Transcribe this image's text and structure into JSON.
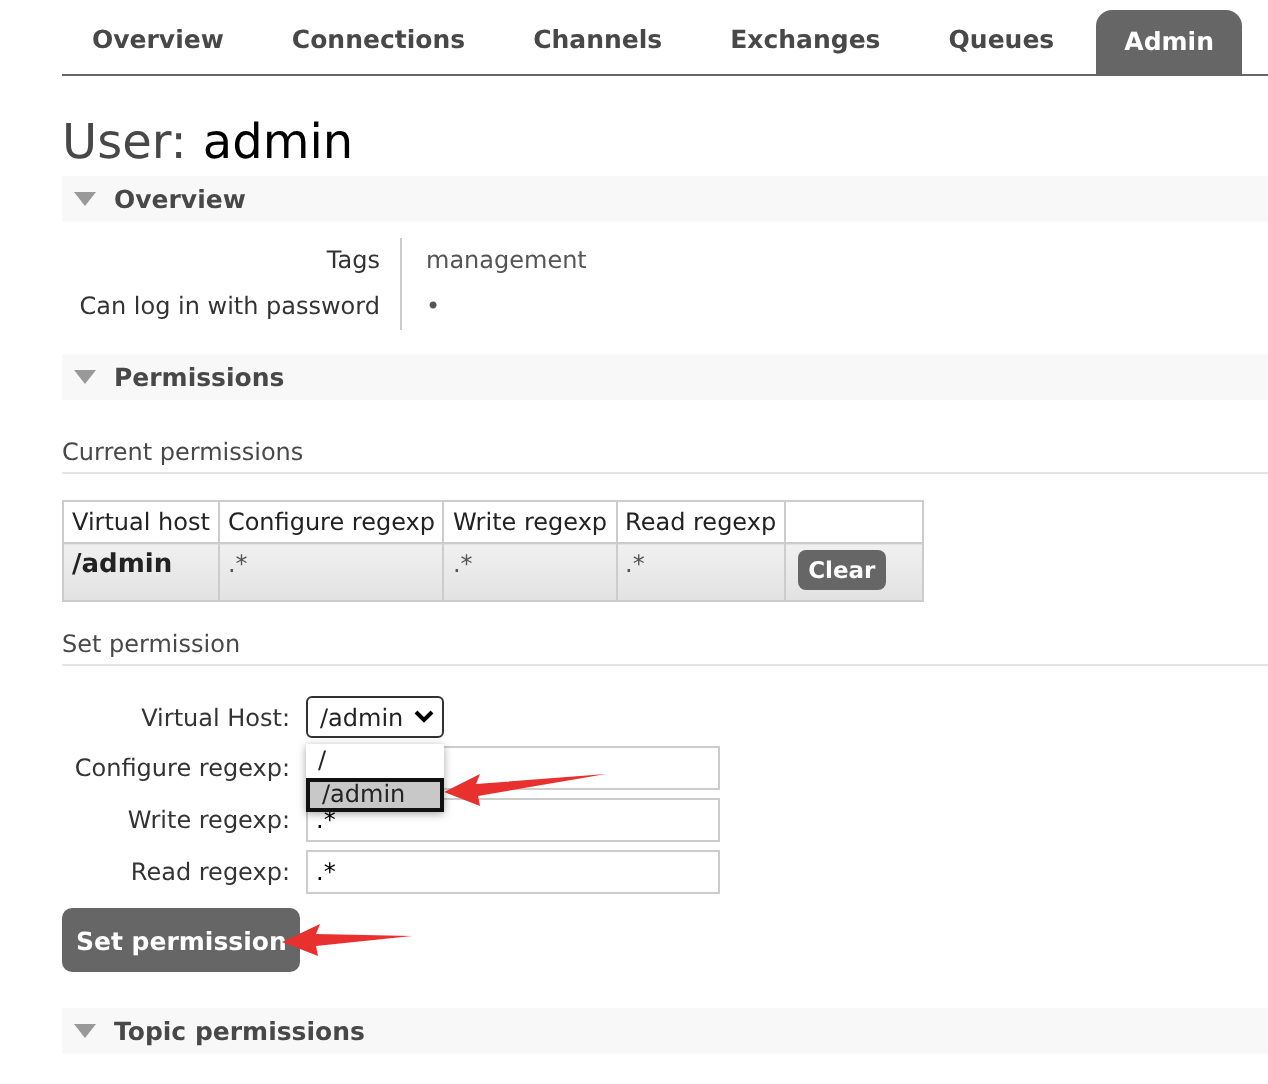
{
  "tabs": [
    {
      "label": "Overview",
      "selected": false
    },
    {
      "label": "Connections",
      "selected": false
    },
    {
      "label": "Channels",
      "selected": false
    },
    {
      "label": "Exchanges",
      "selected": false
    },
    {
      "label": "Queues",
      "selected": false
    },
    {
      "label": "Admin",
      "selected": true
    }
  ],
  "title": {
    "label": "User:",
    "name": "admin"
  },
  "overview": {
    "heading": "Overview",
    "expanded": true,
    "rows": [
      {
        "key": "Tags",
        "value": "management"
      },
      {
        "key": "Can log in with password",
        "value": "•"
      }
    ]
  },
  "permissions": {
    "heading": "Permissions",
    "expanded": true,
    "current": {
      "heading": "Current permissions",
      "columns": [
        "Virtual host",
        "Configure regexp",
        "Write regexp",
        "Read regexp"
      ],
      "rows": [
        {
          "cells": [
            "/admin",
            ".*",
            ".*",
            ".*"
          ],
          "button": "Clear"
        }
      ]
    },
    "set": {
      "heading": "Set permission",
      "virtual_host": {
        "label": "Virtual Host:",
        "value": "/admin",
        "expanded": true,
        "options": [
          {
            "label": "/",
            "selected": false
          },
          {
            "label": "/admin",
            "selected": true
          }
        ]
      },
      "fields": [
        {
          "label": "Configure regexp:"
        },
        {
          "label": "Write regexp:",
          "value": ".*"
        },
        {
          "label": "Read regexp:",
          "value": ".*"
        }
      ],
      "button": "Set permission"
    }
  },
  "topic_permissions": {
    "heading": "Topic permissions",
    "expanded": true
  }
}
